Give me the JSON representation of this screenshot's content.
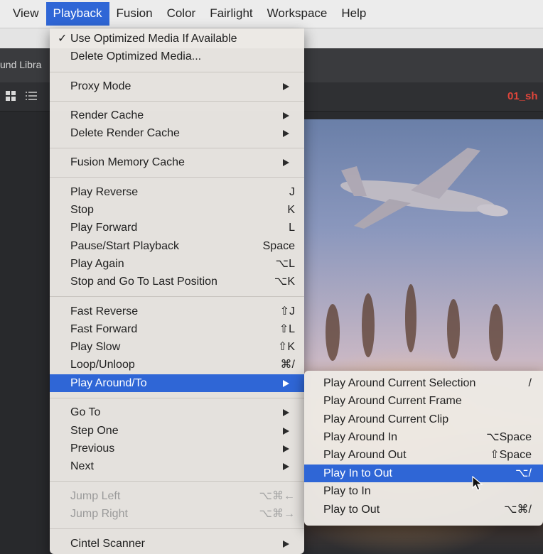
{
  "menubar": {
    "items": [
      {
        "label": "View"
      },
      {
        "label": "Playback"
      },
      {
        "label": "Fusion"
      },
      {
        "label": "Color"
      },
      {
        "label": "Fairlight"
      },
      {
        "label": "Workspace"
      },
      {
        "label": "Help"
      }
    ],
    "active": "Playback"
  },
  "background": {
    "library_label": "und Libra",
    "clip_name": "01_sh"
  },
  "playback_menu": {
    "items": [
      {
        "label": "Use Optimized Media If Available",
        "checked": true,
        "check_mark": "✓"
      },
      {
        "label": "Delete Optimized Media..."
      },
      {
        "label": "Proxy Mode",
        "submenu": true
      },
      {
        "label": "Render Cache",
        "submenu": true
      },
      {
        "label": "Delete Render Cache",
        "submenu": true
      },
      {
        "label": "Fusion Memory Cache",
        "submenu": true
      },
      {
        "label": "Play Reverse",
        "shortcut": "J"
      },
      {
        "label": "Stop",
        "shortcut": "K"
      },
      {
        "label": "Play Forward",
        "shortcut": "L"
      },
      {
        "label": "Pause/Start Playback",
        "shortcut": "Space"
      },
      {
        "label": "Play Again",
        "shortcut": "⌥L"
      },
      {
        "label": "Stop and Go To Last Position",
        "shortcut": "⌥K"
      },
      {
        "label": "Fast Reverse",
        "shortcut": "⇧J"
      },
      {
        "label": "Fast Forward",
        "shortcut": "⇧L"
      },
      {
        "label": "Play Slow",
        "shortcut": "⇧K"
      },
      {
        "label": "Loop/Unloop",
        "shortcut": "⌘/"
      },
      {
        "label": "Play Around/To",
        "submenu": true,
        "highlighted": true
      },
      {
        "label": "Go To",
        "submenu": true
      },
      {
        "label": "Step One",
        "submenu": true
      },
      {
        "label": "Previous",
        "submenu": true
      },
      {
        "label": "Next",
        "submenu": true
      },
      {
        "label": "Jump Left",
        "shortcut": "⌥⌘←",
        "disabled": true
      },
      {
        "label": "Jump Right",
        "shortcut": "⌥⌘→",
        "disabled": true
      },
      {
        "label": "Cintel Scanner",
        "submenu": true
      }
    ]
  },
  "submenu": {
    "items": [
      {
        "label": "Play Around Current Selection",
        "shortcut": "/"
      },
      {
        "label": "Play Around Current Frame"
      },
      {
        "label": "Play Around Current Clip"
      },
      {
        "label": "Play Around In",
        "shortcut": "⌥Space"
      },
      {
        "label": "Play Around Out",
        "shortcut": "⇧Space"
      },
      {
        "label": "Play In to Out",
        "shortcut": "⌥/",
        "highlighted": true
      },
      {
        "label": "Play to In"
      },
      {
        "label": "Play to Out",
        "shortcut": "⌥⌘/"
      }
    ]
  },
  "colors": {
    "highlight": "#2f66d6",
    "menu_bg": "#ece9e5",
    "clip_name": "#e2453a"
  }
}
